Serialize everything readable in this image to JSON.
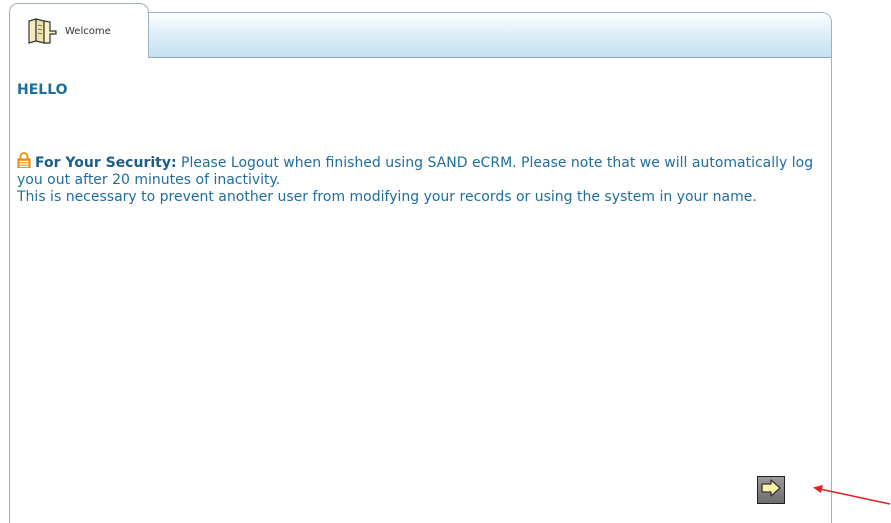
{
  "tabs": [
    {
      "label": "Welcome",
      "icon": "book-icon",
      "active": true
    }
  ],
  "main": {
    "greeting": "HELLO",
    "security": {
      "heading": "For Your Security:",
      "line1": "Please Logout when finished using SAND eCRM. Please note that we will automatically log you out after 20 minutes of inactivity.",
      "line2": "This is necessary to prevent another user from modifying your records or using the system in your name."
    }
  },
  "actions": {
    "next_icon": "arrow-right-icon"
  },
  "colors": {
    "text": "#1f6e9c",
    "lock": "#f0a020",
    "tabbar": "#c4e0f1",
    "annotation": "#e02020"
  }
}
